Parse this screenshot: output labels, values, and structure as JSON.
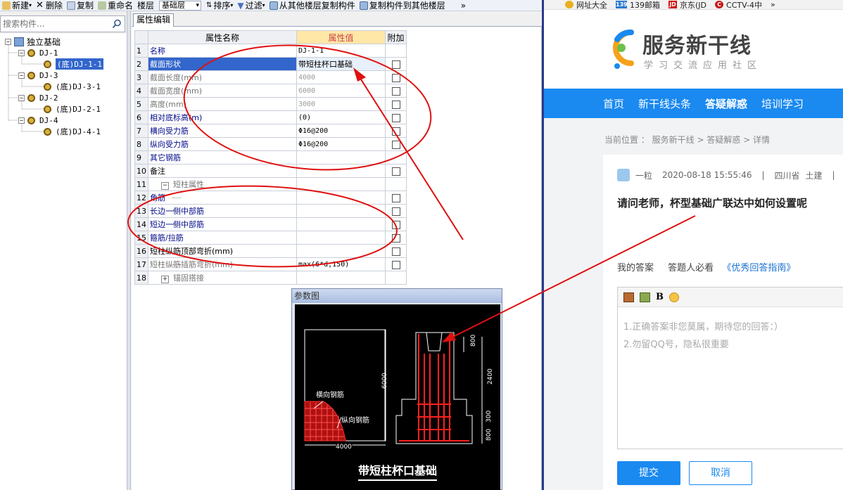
{
  "toolbar": {
    "new_label": "新建",
    "delete_label": "删除",
    "copy_label": "复制",
    "rename_label": "重命名",
    "floor_label": "楼层",
    "floor_value": "基础层",
    "sort_label": "排序",
    "filter_label": "过滤",
    "copy_from_label": "从其他楼层复制构件",
    "copy_to_label": "复制构件到其他楼层",
    "overflow_glyph": "»"
  },
  "search": {
    "placeholder": "搜索构件..."
  },
  "tree": {
    "root": "独立基础",
    "items": [
      {
        "label": "DJ-1",
        "child": "(底)DJ-1-1"
      },
      {
        "label": "DJ-3",
        "child": "(底)DJ-3-1"
      },
      {
        "label": "DJ-2",
        "child": "(底)DJ-2-1"
      },
      {
        "label": "DJ-4",
        "child": "(底)DJ-4-1"
      }
    ]
  },
  "prop_tab": "属性编辑",
  "grid": {
    "col_name": "属性名称",
    "col_value": "属性值",
    "col_extra": "附加",
    "rows": [
      {
        "n": "1",
        "name": "名称",
        "value": "DJ-1-1"
      },
      {
        "n": "2",
        "name": "截面形状",
        "value": "带短柱杯口基础"
      },
      {
        "n": "3",
        "name": "截面长度(mm)",
        "value": "4000"
      },
      {
        "n": "4",
        "name": "截面宽度(mm)",
        "value": "6000"
      },
      {
        "n": "5",
        "name": "高度(mm)",
        "value": "3000"
      },
      {
        "n": "6",
        "name": "相对底标高(m)",
        "value": "(0)"
      },
      {
        "n": "7",
        "name": "横向受力筋",
        "value": "Φ16@200"
      },
      {
        "n": "8",
        "name": "纵向受力筋",
        "value": "Φ16@200"
      },
      {
        "n": "9",
        "name": "其它钢筋",
        "value": ""
      },
      {
        "n": "10",
        "name": "备注",
        "value": ""
      },
      {
        "n": "11",
        "name": "短柱属性",
        "value": ""
      },
      {
        "n": "12",
        "name": "角筋",
        "value": ""
      },
      {
        "n": "13",
        "name": "长边一侧中部筋",
        "value": ""
      },
      {
        "n": "14",
        "name": "短边一侧中部筋",
        "value": ""
      },
      {
        "n": "15",
        "name": "箍筋/拉筋",
        "value": ""
      },
      {
        "n": "16",
        "name": "短柱纵筋顶部弯折(mm)",
        "value": ""
      },
      {
        "n": "17",
        "name": "短柱纵筋插筋弯折(mm)",
        "value": "max(6*d,150)"
      },
      {
        "n": "18",
        "name": "锚固搭接",
        "value": ""
      }
    ]
  },
  "param": {
    "title": "参数图",
    "label_h": "横向钢筋",
    "label_v": "纵向钢筋",
    "dim_6000": "6000",
    "dim_4000": "4000",
    "dim_800": "800",
    "dim_2400": "2400",
    "dim_300": "300",
    "dim_800b": "800",
    "caption": "带短柱杯口基础"
  },
  "browser": {
    "bookmarks": [
      "网址大全",
      "139邮箱",
      "京东(JD",
      "CCTV-4中"
    ],
    "bookmark_icons": [
      "",
      "139",
      "JD",
      "C"
    ],
    "bookmark_more": "»",
    "logo_title": "服务新干线",
    "logo_sub": "学习交流应用社区",
    "nav": [
      "首页",
      "新干线头条",
      "答疑解惑",
      "培训学习"
    ],
    "crumb": "当前位置 ： 服务新干线 > 答疑解惑 > 详情",
    "meta_user": "一粒",
    "meta_time": "2020-08-18 15:55:46",
    "meta_sep": "|",
    "meta_region": "四川省",
    "meta_major": "土建",
    "question": "请问老师，杯型基础广联达中如何设置呢",
    "my_answer": "我的答案",
    "must_read": "答题人必看",
    "guide_link": "《优秀回答指南》",
    "editor_bold": "B",
    "hint1": "1.正确答案非您莫属，期待您的回答：）",
    "hint2": "2.勿留QQ号，隐私很重要",
    "submit": "提交",
    "cancel": "取消"
  },
  "colors": {
    "accent": "#1a89f0",
    "annotation": "#e01010",
    "selection": "#3366cc"
  }
}
